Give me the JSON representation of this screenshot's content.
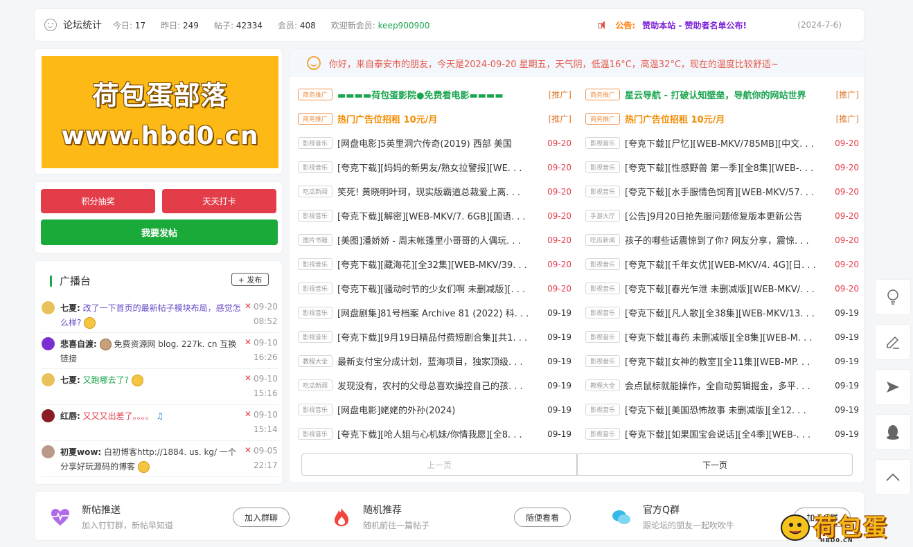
{
  "stats": {
    "title": "论坛统计",
    "today_label": "今日:",
    "today": "17",
    "yesterday_label": "昨日:",
    "yesterday": "249",
    "posts_label": "帖子:",
    "posts": "42334",
    "members_label": "会员:",
    "members": "408",
    "welcome_label": "欢迎新会员:",
    "new_member": "keep900900",
    "notice_label": "公告:",
    "notice_text": "赞助本站 - 赞助者名单公布!",
    "notice_date": "(2024-7-6)"
  },
  "banner": {
    "line1": "荷包蛋部落",
    "line2": "www.hbd0.cn"
  },
  "actions": {
    "lottery": "积分抽奖",
    "checkin": "天天打卡",
    "post": "我要发帖"
  },
  "broadcast": {
    "title": "广播台",
    "publish": "+ 发布",
    "items": [
      {
        "user": "七夏:",
        "text": "改了一下首页的最新帖子模块布局，感觉怎么样?",
        "d1": "09-20",
        "d2": "08:52"
      },
      {
        "user": "悲喜自渡:",
        "text": "免费资源网 blog. 227k. cn 互换链接",
        "d1": "09-10",
        "d2": "16:26"
      },
      {
        "user": "七夏:",
        "text": "又跑哪去了?",
        "d1": "09-10",
        "d2": "15:16"
      },
      {
        "user": "红唇:",
        "text": "又又又出差了。。。。",
        "d1": "09-10",
        "d2": "15:14"
      },
      {
        "user": "初夏wow:",
        "text": "白初博客http://1884. us. kg/ 一个分享好玩源码的博客",
        "d1": "09-05",
        "d2": "22:17"
      }
    ]
  },
  "greeting": "你好，来自泰安市的朋友，今天是2024-09-20 星期五，天气阴，低温16°C，高温32°C，现在的温度比较舒适~",
  "list_left": [
    {
      "tag": "商务推广",
      "title": "▬▬▬▬荷包蛋影院●免费看电影▬▬▬▬",
      "date": "[推广]",
      "type": "adg"
    },
    {
      "tag": "商务推广",
      "title": "热门广告位招租 10元/月",
      "date": "[推广]",
      "type": "ado"
    },
    {
      "tag": "影视音乐",
      "title": "[网盘电影]5英里洞穴传奇(2019) 西部 美国",
      "date": "09-20"
    },
    {
      "tag": "影视音乐",
      "title": "[夸克下载][妈妈的新男友/熟女拉警报][WE. . .",
      "date": "09-20"
    },
    {
      "tag": "吃瓜新闻",
      "title": "笑死! 黄晓明叶珂，现实版霸道总裁爱上离. . .",
      "date": "09-20"
    },
    {
      "tag": "影视音乐",
      "title": "[夸克下载][解密][WEB-MKV/7. 6GB][国语. . .",
      "date": "09-20"
    },
    {
      "tag": "图片书籍",
      "title": "[美图]潘娇娇 - 周末帐篷里小哥哥的人偶玩. . .",
      "date": "09-20"
    },
    {
      "tag": "影视音乐",
      "title": "[夸克下载][藏海花][全32集][WEB-MKV/39. . .",
      "date": "09-20"
    },
    {
      "tag": "影视音乐",
      "title": "[夸克下载][骚动时节的少女们啊 未删减版][. . .",
      "date": "09-20"
    },
    {
      "tag": "影视音乐",
      "title": "[网盘剧集]81号档案 Archive 81 (2022) 科. . .",
      "date": "09-19"
    },
    {
      "tag": "影视音乐",
      "title": "[夸克下载][9月19日精品付费短剧合集][共1. . .",
      "date": "09-19"
    },
    {
      "tag": "教程大全",
      "title": "最新支付宝分成计划，蓝海项目，独家顶级. . .",
      "date": "09-19"
    },
    {
      "tag": "吃瓜新闻",
      "title": "发现没有，农村的父母总喜欢操控自己的孩. . .",
      "date": "09-19"
    },
    {
      "tag": "影视音乐",
      "title": "[网盘电影]姥姥的外孙(2024)",
      "date": "09-19"
    },
    {
      "tag": "影视音乐",
      "title": "[夸克下载][呛人姐与心机妹/你情我愿][全8. . .",
      "date": "09-19"
    }
  ],
  "list_right": [
    {
      "tag": "商务推广",
      "title": "星云导航 - 打破认知壁垒，导航你的网站世界",
      "date": "[推广]",
      "type": "adg"
    },
    {
      "tag": "商务推广",
      "title": "热门广告位招租 10元/月",
      "date": "[推广]",
      "type": "ado"
    },
    {
      "tag": "影视音乐",
      "title": "[夸克下载][尸忆][WEB-MKV/785MB][中文. . .",
      "date": "09-20"
    },
    {
      "tag": "影视音乐",
      "title": "[夸克下载][性感野兽 第一季][全8集][WEB-. . .",
      "date": "09-20"
    },
    {
      "tag": "影视音乐",
      "title": "[夸克下载][水手服情色饲育][WEB-MKV/57. . .",
      "date": "09-20"
    },
    {
      "tag": "手游大厅",
      "title": "[公告]9月20日抢先服问题修复版本更新公告",
      "date": "09-20"
    },
    {
      "tag": "吃瓜新闻",
      "title": "孩子的哪些话震惊到了你? 网友分享，震惊. . .",
      "date": "09-20"
    },
    {
      "tag": "影视音乐",
      "title": "[夸克下载][千年女优][WEB-MKV/4. 4G][日. . .",
      "date": "09-20"
    },
    {
      "tag": "影视音乐",
      "title": "[夸克下载][春光乍泄 未删减版][WEB-MKV/. . .",
      "date": "09-20"
    },
    {
      "tag": "影视音乐",
      "title": "[夸克下载][凡人歌][全38集][WEB-MKV/13. . .",
      "date": "09-19"
    },
    {
      "tag": "影视音乐",
      "title": "[夸克下载][毒药 未删减版][全8集][WEB-M. . .",
      "date": "09-19"
    },
    {
      "tag": "影视音乐",
      "title": "[夸克下载][女神的教室][全11集][WEB-MP. . .",
      "date": "09-19"
    },
    {
      "tag": "教程大全",
      "title": "会点鼠标就能操作，全自动剪辑掘金，多平. . .",
      "date": "09-19"
    },
    {
      "tag": "影视音乐",
      "title": "[夸克下载][美国恐怖故事 未删减版][全12. . .",
      "date": "09-19"
    },
    {
      "tag": "影视音乐",
      "title": "[夸克下载][如果国宝会说话][全4季][WEB-. . .",
      "date": "09-19"
    }
  ],
  "pager": {
    "prev": "上一页",
    "next": "下一页"
  },
  "bottom": [
    {
      "title": "新帖推送",
      "sub": "加入钉钉群，新帖早知道",
      "btn": "加入群聊"
    },
    {
      "title": "随机推荐",
      "sub": "随机前往一篇帖子",
      "btn": "随便看看"
    },
    {
      "title": "官方Q群",
      "sub": "跟论坛的朋友一起吹吹牛",
      "btn": "加入Q群"
    }
  ],
  "logo": {
    "text": "荷包蛋",
    "sub": "HBD0.CN"
  },
  "colors": {
    "accent_green": "#1aa54f",
    "red": "#e43d4a",
    "orange": "#f38b00",
    "banner": "#fdb915"
  }
}
